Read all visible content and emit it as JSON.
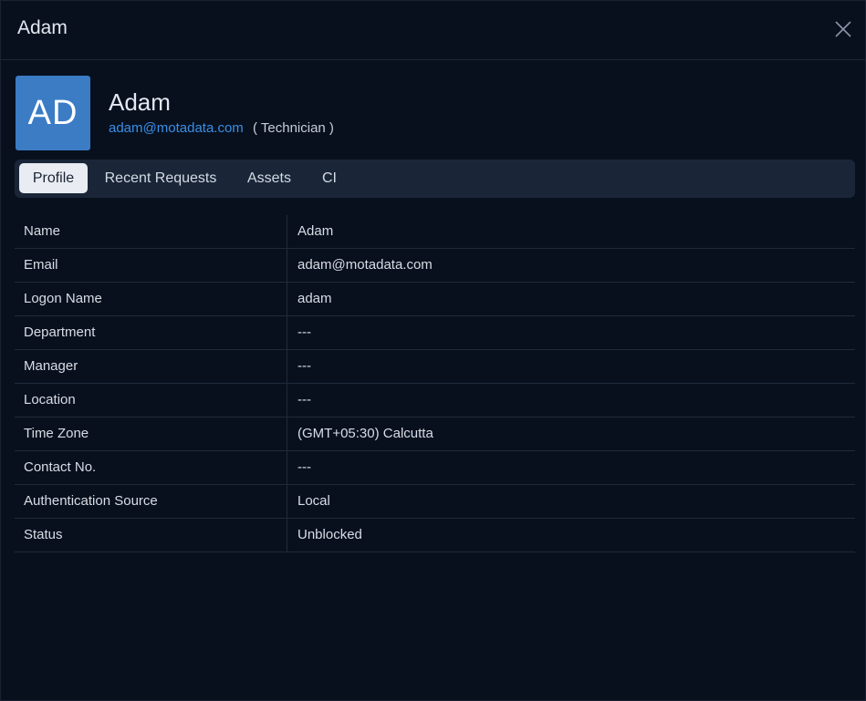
{
  "dialog": {
    "title": "Adam",
    "close_icon": "close-icon"
  },
  "user": {
    "initials": "AD",
    "name": "Adam",
    "email": "adam@motadata.com",
    "role": "( Technician )"
  },
  "tabs": [
    {
      "label": "Profile",
      "active": true
    },
    {
      "label": "Recent Requests",
      "active": false
    },
    {
      "label": "Assets",
      "active": false
    },
    {
      "label": "CI",
      "active": false
    }
  ],
  "profile": [
    {
      "label": "Name",
      "value": "Adam"
    },
    {
      "label": "Email",
      "value": "adam@motadata.com"
    },
    {
      "label": "Logon Name",
      "value": "adam"
    },
    {
      "label": "Department",
      "value": "---"
    },
    {
      "label": "Manager",
      "value": "---"
    },
    {
      "label": "Location",
      "value": "---"
    },
    {
      "label": "Time Zone",
      "value": "(GMT+05:30) Calcutta"
    },
    {
      "label": "Contact No.",
      "value": "---"
    },
    {
      "label": "Authentication Source",
      "value": "Local"
    },
    {
      "label": "Status",
      "value": "Unblocked"
    }
  ],
  "colors": {
    "background": "#08101e",
    "avatar": "#3b7cc5",
    "link": "#3a8fe6",
    "tab_bar": "#1a2638",
    "tab_active": "#e9edf3"
  }
}
